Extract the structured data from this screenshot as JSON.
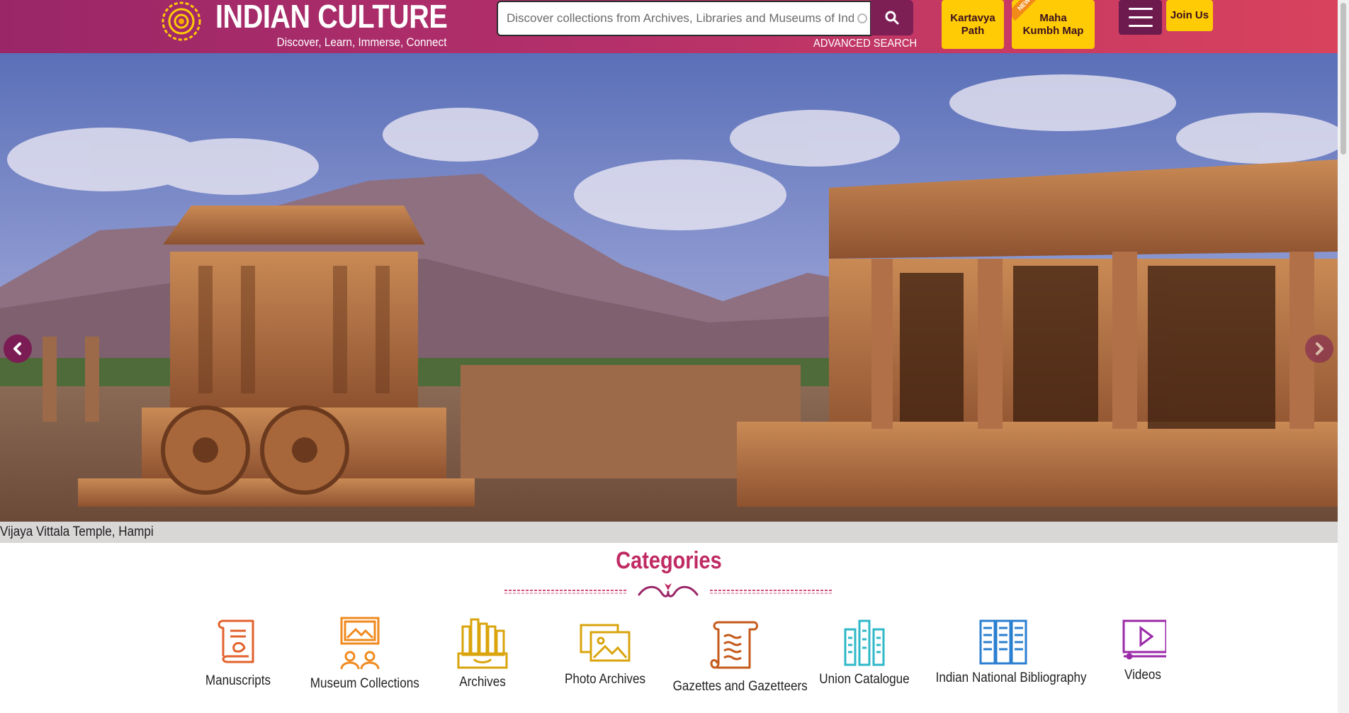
{
  "header": {
    "logo_title": "INDIAN CULTURE",
    "logo_tagline": "Discover, Learn, Immerse, Connect",
    "search_placeholder": "Discover collections from Archives, Libraries and Museums of India",
    "advanced_search": "ADVANCED SEARCH",
    "kartavya_path": "Kartavya Path",
    "maha_kumbh_map": "Maha Kumbh Map",
    "new_badge": "NEW",
    "join_us": "Join Us",
    "colors": {
      "brand_start": "#9a2668",
      "brand_end": "#d8425d",
      "accent_yellow": "#ffcb05"
    }
  },
  "hero": {
    "caption": "Vijaya Vittala Temple, Hampi",
    "prev_icon": "chevron-left-icon",
    "next_icon": "chevron-right-icon"
  },
  "categories": {
    "title": "Categories",
    "items": [
      {
        "label": "Manuscripts",
        "icon": "scroll-icon"
      },
      {
        "label": "Museum Collections",
        "icon": "museum-icon"
      },
      {
        "label": "Archives",
        "icon": "archive-icon"
      },
      {
        "label": "Photo Archives",
        "icon": "photo-icon"
      },
      {
        "label": "Gazettes and Gazetteers",
        "icon": "gazette-icon"
      },
      {
        "label": "Union Catalogue",
        "icon": "catalogue-icon"
      },
      {
        "label": "Indian National Bibliography",
        "icon": "bibliography-icon"
      },
      {
        "label": "Videos",
        "icon": "video-icon"
      }
    ]
  }
}
